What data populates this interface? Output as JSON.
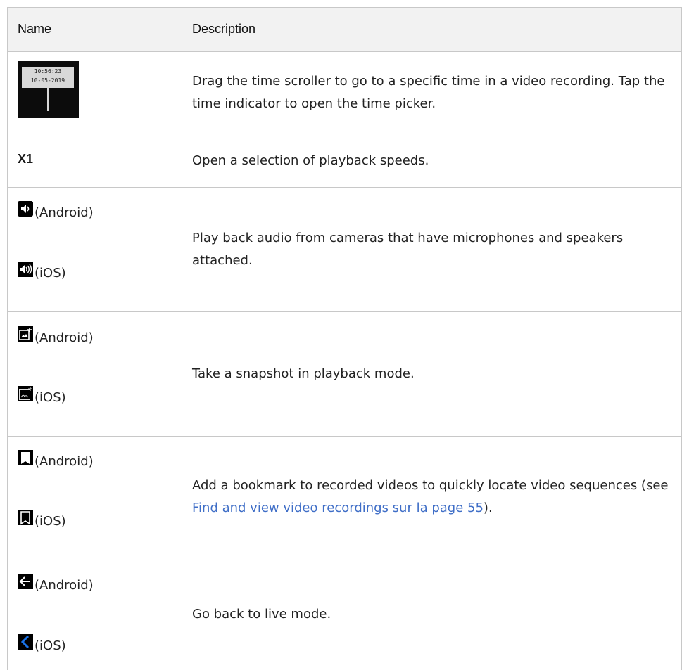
{
  "header": {
    "name": "Name",
    "description": "Description"
  },
  "rows": [
    {
      "id": "time-scroller",
      "image_text": [
        "10:56:23",
        "10-05-2019"
      ],
      "description": "Drag the time scroller to go to a specific time in a video recording. Tap the time indicator to open the time picker."
    },
    {
      "id": "speed",
      "name_text": "X1",
      "description": "Open a selection of playback speeds."
    },
    {
      "id": "audio",
      "items": [
        {
          "icon": "speaker-icon",
          "label": "(Android)"
        },
        {
          "icon": "speaker-waves-icon",
          "label": "(iOS)"
        }
      ],
      "description": "Play back audio from cameras that have microphones and speakers attached."
    },
    {
      "id": "snapshot",
      "items": [
        {
          "icon": "add-photo-icon",
          "label": "(Android)"
        },
        {
          "icon": "add-photo-outline-icon",
          "label": "(iOS)"
        }
      ],
      "description": "Take a snapshot in playback mode."
    },
    {
      "id": "bookmark",
      "items": [
        {
          "icon": "bookmark-icon",
          "label": "(Android)"
        },
        {
          "icon": "bookmark-outline-icon",
          "label": "(iOS)"
        }
      ],
      "description_pre": "Add a bookmark to recorded videos to quickly locate video sequences (see ",
      "description_link": "Find and view video recordings sur la page 55",
      "description_post": ")."
    },
    {
      "id": "back",
      "items": [
        {
          "icon": "arrow-left-icon",
          "label": "(Android)"
        },
        {
          "icon": "chevron-left-icon",
          "label": "(iOS)"
        }
      ],
      "description": "Go back to live mode."
    }
  ],
  "colors": {
    "border": "#c8c8c8",
    "header_bg": "#f2f2f2",
    "link": "#3f6ec7",
    "ios_back": "#1a73e8"
  }
}
